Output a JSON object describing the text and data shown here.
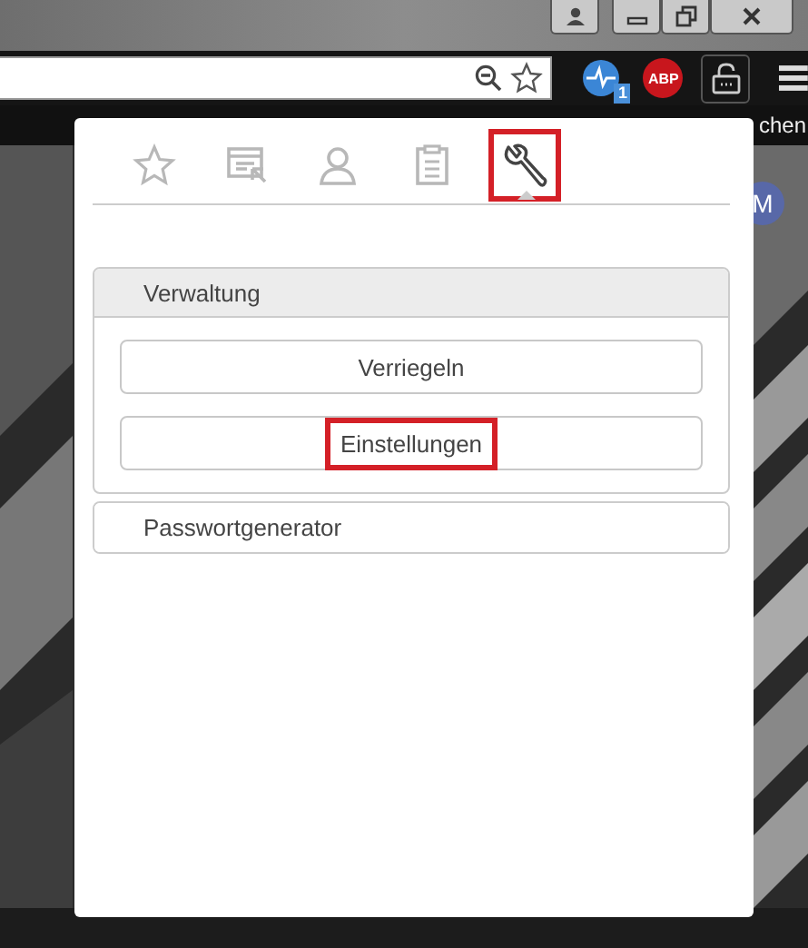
{
  "toolbar": {
    "extension_badge": "1",
    "adblock_label": "ABP"
  },
  "bookmarks_bar": {
    "item": "chen"
  },
  "avatar": {
    "letter": "M"
  },
  "popup": {
    "tabs": [
      {
        "kind": "star",
        "selected": false,
        "highlighted": false
      },
      {
        "kind": "form",
        "selected": false,
        "highlighted": false
      },
      {
        "kind": "contact",
        "selected": false,
        "highlighted": false
      },
      {
        "kind": "clipboard",
        "selected": false,
        "highlighted": false
      },
      {
        "kind": "wrench",
        "selected": true,
        "highlighted": true
      }
    ],
    "sections": [
      {
        "title": "Verwaltung",
        "expanded": true,
        "buttons": [
          {
            "label": "Verriegeln",
            "highlighted": false
          },
          {
            "label": "Einstellungen",
            "highlighted": true
          }
        ]
      },
      {
        "title": "Passwortgenerator",
        "expanded": false
      }
    ]
  }
}
